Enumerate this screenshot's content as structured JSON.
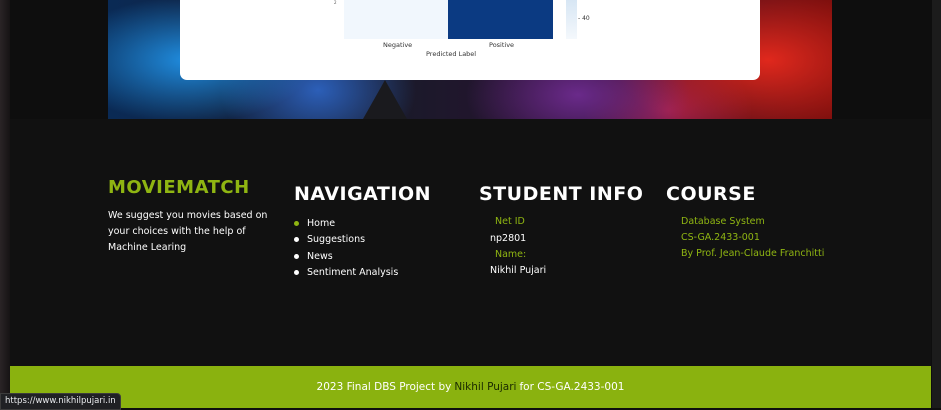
{
  "chart": {
    "x_ticks": [
      "Negative",
      "Positive"
    ],
    "xlabel": "Predicted Label",
    "colorbar_tick": "- 40"
  },
  "footer": {
    "brand": "MOVIEMATCH",
    "brand_description": "We suggest you movies based on your choices with the help of Machine Learing",
    "navigation": {
      "heading": "NAVIGATION",
      "items": [
        "Home",
        "Suggestions",
        "News",
        "Sentiment Analysis"
      ]
    },
    "student_info": {
      "heading": "STUDENT INFO",
      "net_id_label": "Net ID",
      "net_id": "np2801",
      "name_label": "Name:",
      "name": "Nikhil Pujari"
    },
    "course": {
      "heading": "COURSE",
      "lines": [
        "Database System",
        "CS-GA.2433-001",
        "By Prof. Jean-Claude Franchitti"
      ]
    }
  },
  "bottom_bar": {
    "prefix": "2023 Final DBS Project by",
    "author": "Nikhil Pujari",
    "suffix": "for CS-GA.2433-001"
  },
  "status_bar": {
    "url": "https://www.nikhilpujari.in"
  },
  "colors": {
    "accent": "#8fb512",
    "footer_bg": "#111111",
    "bar_bg": "#8ab20f"
  }
}
